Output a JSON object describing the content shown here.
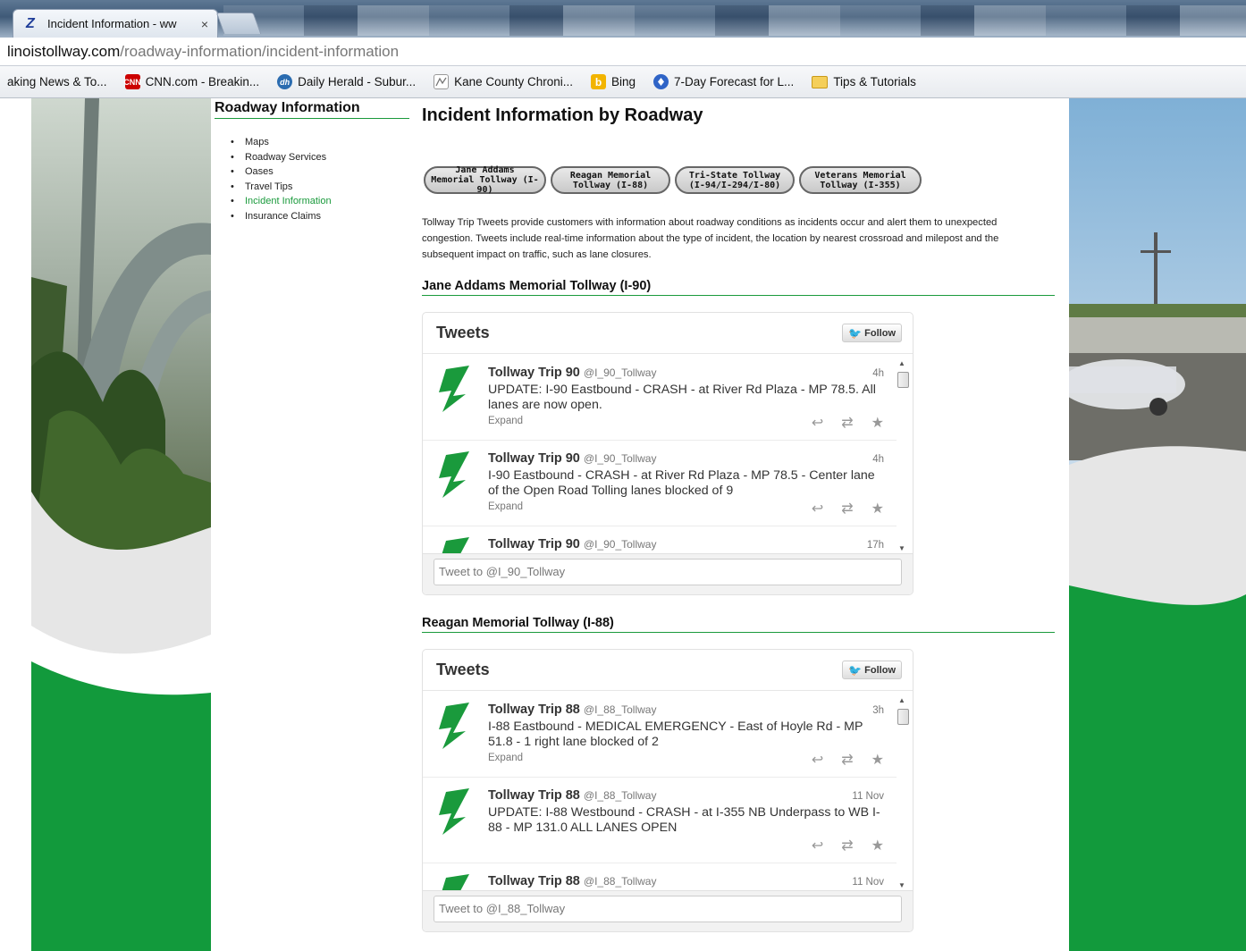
{
  "browser": {
    "tab_title": "Incident Information - ww",
    "tab_close": "×",
    "url_host": "linoistollway.com",
    "url_path": "/roadway-information/incident-information",
    "bookmarks": [
      {
        "label": "aking News & To...",
        "icon": "none"
      },
      {
        "label": "CNN.com - Breakin...",
        "icon": "cnn-icon",
        "icon_text": "CNN"
      },
      {
        "label": "Daily Herald - Subur...",
        "icon": "daily-herald-icon",
        "icon_text": "dh"
      },
      {
        "label": "Kane County Chroni...",
        "icon": "kane-county-icon",
        "icon_text": ""
      },
      {
        "label": "Bing",
        "icon": "bing-icon",
        "icon_text": "b"
      },
      {
        "label": "7-Day Forecast for L...",
        "icon": "weather-icon",
        "icon_text": ""
      },
      {
        "label": "Tips & Tutorials",
        "icon": "folder-icon",
        "icon_text": ""
      }
    ]
  },
  "sidebar": {
    "title": "Roadway Information",
    "items": [
      {
        "label": "Maps",
        "active": false
      },
      {
        "label": "Roadway Services",
        "active": false
      },
      {
        "label": "Oases",
        "active": false
      },
      {
        "label": "Travel Tips",
        "active": false
      },
      {
        "label": "Incident Information",
        "active": true
      },
      {
        "label": "Insurance Claims",
        "active": false
      }
    ]
  },
  "main": {
    "title": "Incident Information by Roadway",
    "roadway_buttons": [
      {
        "line1": "Jane Addams",
        "line2": "Memorial Tollway (I-90)"
      },
      {
        "line1": "Reagan Memorial",
        "line2": "Tollway (I-88)"
      },
      {
        "line1": "Tri-State Tollway",
        "line2": "(I-94/I-294/I-80)"
      },
      {
        "line1": "Veterans Memorial",
        "line2": "Tollway (I-355)"
      }
    ],
    "intro": "Tollway Trip Tweets provide customers with information about roadway conditions as incidents occur and alert them to unexpected congestion. Tweets include real-time information about the type of incident, the location by nearest crossroad and milepost and the subsequent impact on traffic, such as lane closures.",
    "sections": [
      {
        "heading": "Jane Addams Memorial Tollway (I-90)",
        "widget": {
          "title": "Tweets",
          "follow": "Follow",
          "input_placeholder": "Tweet to @I_90_Tollway",
          "tweets": [
            {
              "name": "Tollway Trip 90",
              "handle": "@I_90_Tollway",
              "time": "4h",
              "text": "UPDATE: I-90 Eastbound - CRASH - at River Rd Plaza - MP 78.5. All lanes are now open.",
              "expand": "Expand"
            },
            {
              "name": "Tollway Trip 90",
              "handle": "@I_90_Tollway",
              "time": "4h",
              "text": "I-90 Eastbound - CRASH - at River Rd Plaza - MP 78.5 - Center lane of the Open Road Tolling lanes blocked of 9",
              "expand": "Expand"
            },
            {
              "name": "Tollway Trip 90",
              "handle": "@I_90_Tollway",
              "time": "17h",
              "text": "",
              "expand": ""
            }
          ]
        }
      },
      {
        "heading": "Reagan Memorial Tollway (I-88)",
        "widget": {
          "title": "Tweets",
          "follow": "Follow",
          "input_placeholder": "Tweet to @I_88_Tollway",
          "tweets": [
            {
              "name": "Tollway Trip 88",
              "handle": "@I_88_Tollway",
              "time": "3h",
              "text": "I-88 Eastbound - MEDICAL EMERGENCY - East of Hoyle Rd - MP 51.8 - 1 right lane blocked of 2",
              "expand": "Expand"
            },
            {
              "name": "Tollway Trip 88",
              "handle": "@I_88_Tollway",
              "time": "11 Nov",
              "text": "UPDATE: I-88 Westbound - CRASH - at I-355 NB Underpass to WB I-88 - MP 131.0 ALL LANES OPEN",
              "expand": ""
            },
            {
              "name": "Tollway Trip 88",
              "handle": "@I_88_Tollway",
              "time": "11 Nov",
              "text": "",
              "expand": ""
            }
          ]
        }
      }
    ]
  },
  "colors": {
    "tollway_green": "#1a9a3c",
    "twitter_blue": "#2aa9e0"
  }
}
